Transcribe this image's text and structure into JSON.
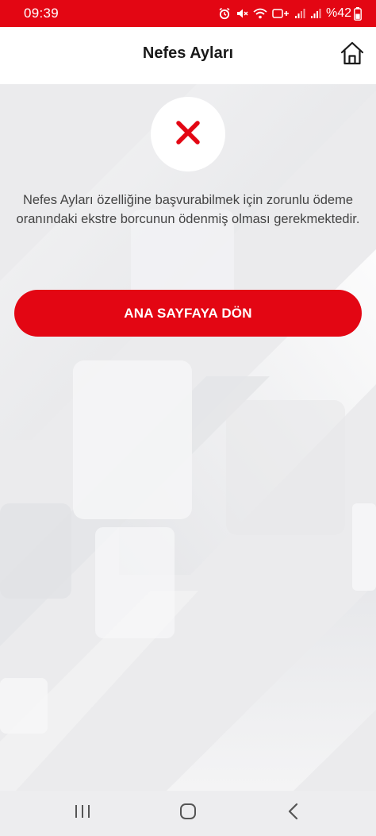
{
  "status_bar": {
    "time": "09:39",
    "battery": "%42",
    "icons": [
      "alarm-icon",
      "mute-icon",
      "wifi-icon",
      "volte-icon",
      "signal-icon",
      "signal-icon",
      "battery-icon"
    ]
  },
  "header": {
    "title": "Nefes Ayları",
    "home_icon": "home-icon"
  },
  "error": {
    "icon": "close-x-icon",
    "message": "Nefes Ayları özelliğine başvurabilmek için zorunlu ödeme oranındaki ekstre borcunun ödenmiş olması gerekmektedir."
  },
  "actions": {
    "home_button_label": "ANA SAYFAYA DÖN"
  },
  "nav_bar": {
    "recents_icon": "recents-icon",
    "home_icon": "home-circle-icon",
    "back_icon": "back-icon"
  },
  "colors": {
    "brand_red": "#e30613",
    "background": "#ececee",
    "text_dark": "#1a1a1a",
    "text_body": "#444444"
  }
}
